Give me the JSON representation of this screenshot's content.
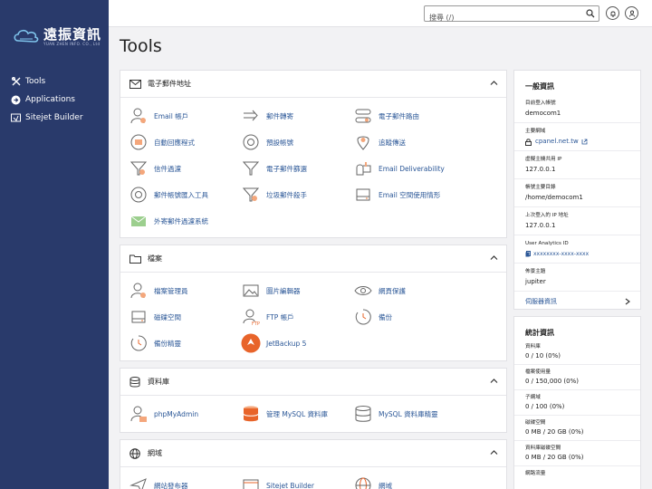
{
  "brand": {
    "title": "遠振資訊",
    "subtitle": "YUAN ZHEN INFO. CO., Ltd"
  },
  "sidebar": {
    "items": [
      {
        "label": "Tools",
        "icon": "tools-icon"
      },
      {
        "label": "Applications",
        "icon": "applications-icon"
      },
      {
        "label": "Sitejet Builder",
        "icon": "sitejet-icon"
      }
    ]
  },
  "topbar": {
    "search_placeholder": "搜尋 (/)"
  },
  "page": {
    "title": "Tools"
  },
  "sections": [
    {
      "title": "電子郵件地址",
      "icon": "envelope-icon",
      "items": [
        {
          "label": "Email 帳戶",
          "icon": "email-accounts-icon"
        },
        {
          "label": "郵件轉寄",
          "icon": "forwarders-icon"
        },
        {
          "label": "電子郵件路由",
          "icon": "email-routing-icon"
        },
        {
          "label": "自動回應程式",
          "icon": "autoresponders-icon"
        },
        {
          "label": "預設帳號",
          "icon": "default-address-icon"
        },
        {
          "label": "追蹤傳送",
          "icon": "track-delivery-icon"
        },
        {
          "label": "信件過濾",
          "icon": "email-filters-icon"
        },
        {
          "label": "電子郵件篩選",
          "icon": "global-email-filters-icon"
        },
        {
          "label": "Email Deliverability",
          "icon": "mailbox-icon"
        },
        {
          "label": "郵件帳號匯入工具",
          "icon": "import-tool-icon"
        },
        {
          "label": "垃圾郵件殺手",
          "icon": "spam-filter-icon"
        },
        {
          "label": "Email 空間使用情形",
          "icon": "disk-usage-icon"
        },
        {
          "label": "外寄郵件過濾系統",
          "icon": "outgoing-filter-icon"
        }
      ]
    },
    {
      "title": "檔案",
      "icon": "folder-icon",
      "items": [
        {
          "label": "檔案管理員",
          "icon": "file-manager-icon"
        },
        {
          "label": "圖片編輯器",
          "icon": "images-icon"
        },
        {
          "label": "網頁保護",
          "icon": "directory-privacy-icon"
        },
        {
          "label": "磁碟空間",
          "icon": "disk-usage-icon"
        },
        {
          "label": "FTP 帳戶",
          "icon": "ftp-accounts-icon"
        },
        {
          "label": "備份",
          "icon": "backup-icon"
        },
        {
          "label": "備份精靈",
          "icon": "backup-wizard-icon"
        },
        {
          "label": "JetBackup 5",
          "icon": "jetbackup-icon"
        }
      ]
    },
    {
      "title": "資料庫",
      "icon": "database-icon",
      "items": [
        {
          "label": "phpMyAdmin",
          "icon": "phpmyadmin-icon"
        },
        {
          "label": "管理 MySQL 資料庫",
          "icon": "mysql-databases-icon"
        },
        {
          "label": "MySQL 資料庫精靈",
          "icon": "mysql-wizard-icon"
        }
      ]
    },
    {
      "title": "網域",
      "icon": "globe-icon",
      "items": [
        {
          "label": "網站發布器",
          "icon": "site-publisher-icon"
        },
        {
          "label": "Sitejet Builder",
          "icon": "sitejet-builder-icon"
        },
        {
          "label": "網域",
          "icon": "domains-icon"
        }
      ]
    }
  ],
  "general_info": {
    "title": "一般資訊",
    "current_user_label": "目前登入帳號",
    "current_user": "democom1",
    "primary_domain_label": "主要網域",
    "primary_domain": "cpanel.net.tw",
    "shared_ip_label": "虛擬主機共用 IP",
    "shared_ip": "127.0.0.1",
    "home_dir_label": "帳號主要目錄",
    "home_dir": "/home/democom1",
    "last_ip_label": "上次登入的 IP 地址",
    "last_ip": "127.0.0.1",
    "analytics_label": "User Analytics ID",
    "analytics_id": "xxxxxxxx-xxxx-xxxx",
    "theme_label": "佈景主題",
    "theme": "jupiter",
    "server_info_label": "伺服器資訊"
  },
  "statistics": {
    "title": "統計資訊",
    "rows": [
      {
        "label": "資料庫",
        "value": "0 / 10   (0%)"
      },
      {
        "label": "檔案使用量",
        "value": "0 / 150,000   (0%)"
      },
      {
        "label": "子網域",
        "value": "0 / 100   (0%)"
      },
      {
        "label": "磁碟空間",
        "value": "0 MB / 20 GB   (0%)"
      },
      {
        "label": "資料庫磁碟空間",
        "value": "0 MB / 20 GB   (0%)"
      },
      {
        "label": "網路流量",
        "value": ""
      }
    ]
  },
  "colors": {
    "sidebar": "#293a6b",
    "link": "#2b5797",
    "accent": "#e8642a"
  }
}
